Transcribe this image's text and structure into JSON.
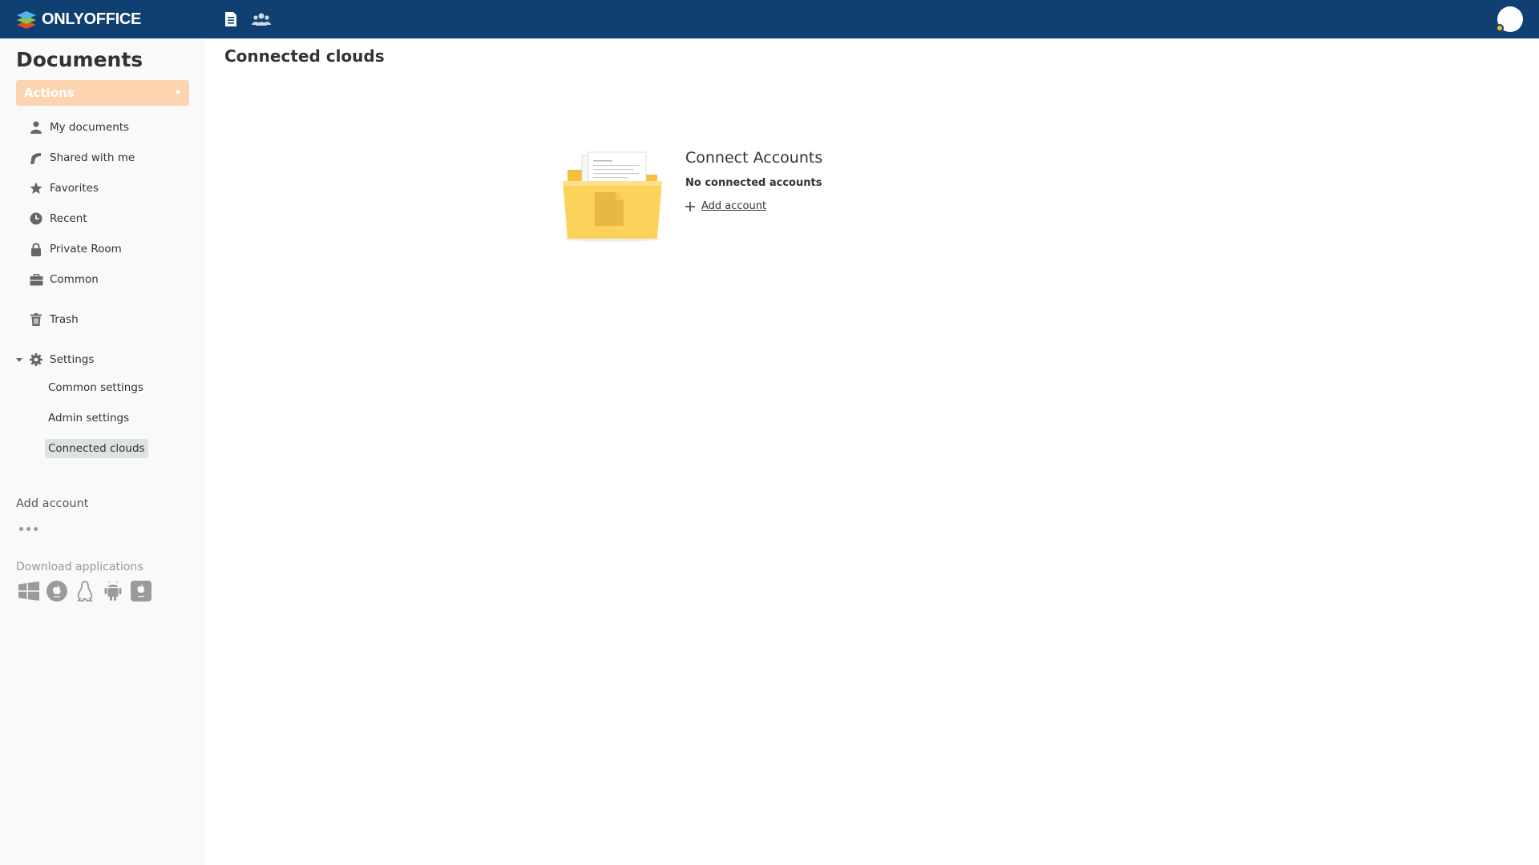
{
  "header": {
    "brand": "ONLYOFFICE",
    "icons": [
      "documents-icon",
      "people-icon"
    ],
    "colors": {
      "background": "#0f4071",
      "status_dot": "#f3c217"
    }
  },
  "sidebar": {
    "title": "Documents",
    "actions_label": "Actions",
    "items": [
      {
        "label": "My documents",
        "icon": "user-icon"
      },
      {
        "label": "Shared with me",
        "icon": "shared-icon"
      },
      {
        "label": "Favorites",
        "icon": "star-icon"
      },
      {
        "label": "Recent",
        "icon": "clock-icon"
      },
      {
        "label": "Private Room",
        "icon": "lock-icon"
      },
      {
        "label": "Common",
        "icon": "briefcase-icon"
      },
      {
        "label": "Trash",
        "icon": "trash-icon"
      }
    ],
    "settings": {
      "label": "Settings",
      "icon": "gear-icon",
      "expanded": true,
      "children": [
        "Common settings",
        "Admin settings",
        "Connected clouds"
      ],
      "active": "Connected clouds"
    },
    "add_account": "Add account",
    "download_label": "Download applications",
    "apps": [
      "windows-icon",
      "macos-icon",
      "linux-icon",
      "android-icon",
      "ios-icon"
    ]
  },
  "main": {
    "title": "Connected clouds",
    "empty": {
      "title": "Connect Accounts",
      "subtitle": "No connected accounts",
      "add_label": "Add account"
    }
  }
}
